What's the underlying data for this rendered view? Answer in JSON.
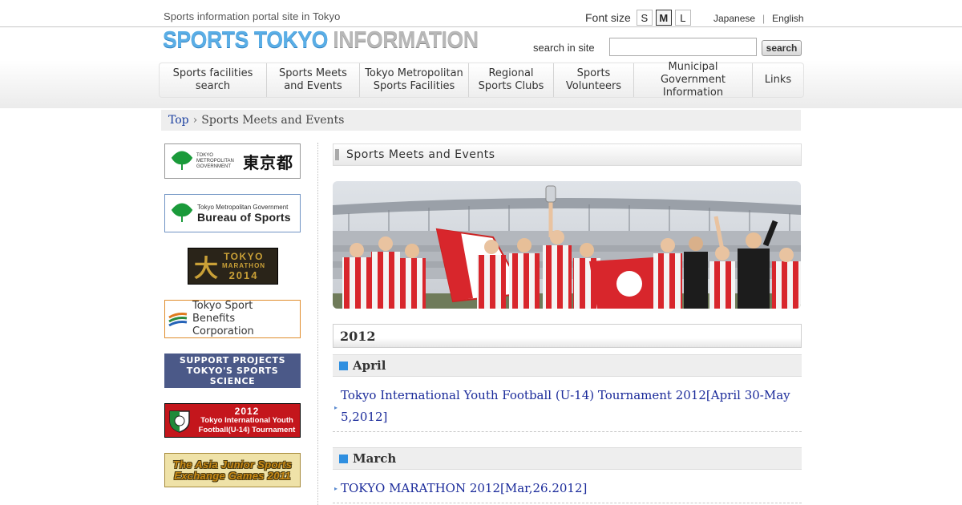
{
  "header": {
    "tagline": "Sports information portal site in Tokyo",
    "logo_sports": "SPORTS TOKYO",
    "logo_info": "INFORMATION",
    "font_size_label": "Font size",
    "font_sizes": [
      "S",
      "M",
      "L"
    ],
    "font_size_selected": "M",
    "languages": [
      "Japanese",
      "English"
    ],
    "search_label": "search in site",
    "search_value": "",
    "search_button": "search"
  },
  "nav": {
    "items": [
      {
        "line1": "Sports facilities",
        "line2": "search"
      },
      {
        "line1": "Sports Meets",
        "line2": "and Events"
      },
      {
        "line1": "Tokyo Metropolitan",
        "line2": "Sports Facilities"
      },
      {
        "line1": "Regional",
        "line2": "Sports Clubs"
      },
      {
        "line1": "Sports",
        "line2": "Volunteers"
      },
      {
        "line1": "Municipal Government",
        "line2": "Information"
      },
      {
        "line1": "Links",
        "line2": ""
      }
    ]
  },
  "breadcrumb": {
    "top": "Top",
    "separator": "›",
    "current": "Sports Meets and Events"
  },
  "sidebar": {
    "gov": {
      "small": "TOKYO METROPOLITAN GOVERNMENT",
      "kanji": "東京都"
    },
    "bureau": {
      "small": "Tokyo Metropolitan Government",
      "big": "Bureau of Sports"
    },
    "marathon": {
      "mark": "大",
      "line1": "TOKYO",
      "line2": "MARATHON",
      "line3": "2014"
    },
    "tsbc": {
      "line1": "Tokyo Sport",
      "line2": "Benefits Corporation"
    },
    "support": {
      "line1": "SUPPORT PROJECTS",
      "line2": "TOKYO'S SPORTS SCIENCE"
    },
    "u14": {
      "year": "2012",
      "line1": "Tokyo International Youth",
      "line2": "Football(U-14) Tournament"
    },
    "asia": {
      "line1": "The Asia Junior Sports",
      "line2": "Exchange Games 2011"
    }
  },
  "main": {
    "section_title": "Sports Meets and Events",
    "year": "2012",
    "months": [
      {
        "name": "April",
        "events": [
          {
            "line1": "Tokyo International Youth Football (U-14) Tournament 2012[April 30-May",
            "line2": "5,2012]"
          }
        ]
      },
      {
        "name": "March",
        "events": [
          {
            "line1": "TOKYO MARATHON 2012[Mar,26.2012]",
            "line2": ""
          }
        ]
      }
    ]
  },
  "colors": {
    "logo_blue": "#5aaee6",
    "link_blue": "#1a2a9a",
    "month_square": "#2f8fe0",
    "team_red": "#d8262c"
  }
}
